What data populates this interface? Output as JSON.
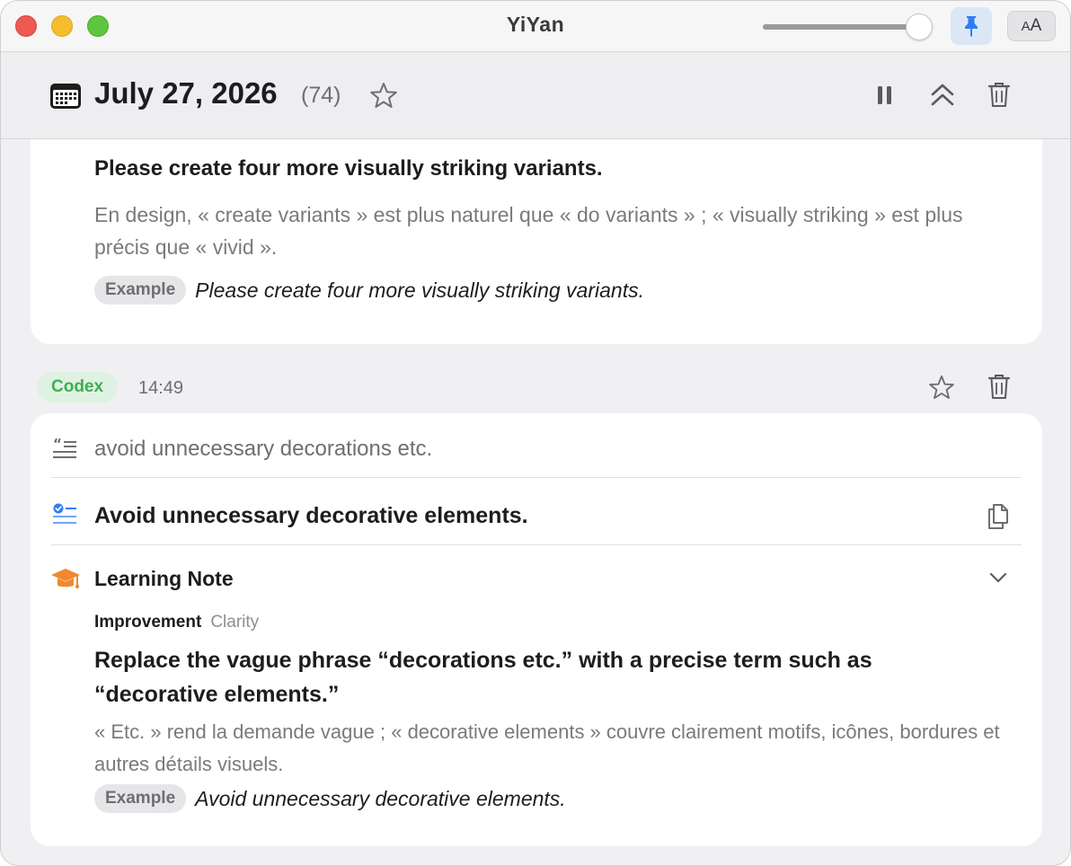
{
  "window": {
    "title": "YiYan"
  },
  "toolbar": {
    "font_label_small": "A",
    "font_label_large": "A",
    "opacity_fraction": 0.9
  },
  "header": {
    "date": "July 27, 2026",
    "count": "(74)"
  },
  "card1": {
    "corrected": "Please create four more visually striking variants.",
    "explanation": "En design, « create variants » est plus naturel que « do variants » ; « visually striking » est plus précis que « vivid ».",
    "example_label": "Example",
    "example": "Please create four more visually striking variants."
  },
  "entry": {
    "source": "Codex",
    "time": "14:49"
  },
  "card2": {
    "original": "avoid unnecessary decorations etc.",
    "corrected": "Avoid unnecessary decorative elements.",
    "note_title": "Learning Note",
    "note_category": "Improvement",
    "note_subcategory": "Clarity",
    "note_heading": "Replace the vague phrase “decorations etc.” with a precise term such as “decorative elements.”",
    "note_explanation": "« Etc. » rend la demande vague ; « decorative elements » couvre clairement motifs, icônes, bordures et autres détails visuels.",
    "example_label": "Example",
    "example": "Avoid unnecessary decorative elements."
  },
  "colors": {
    "accent_blue": "#2f7df6",
    "codex_green": "#3fae52",
    "note_orange": "#f0892e"
  },
  "icons": {
    "calendar": "calendar-icon",
    "star": "star-icon",
    "pause": "pause-icon",
    "collapse": "chevron-double-up-icon",
    "trash": "trash-icon",
    "pin": "pin-icon",
    "quote": "quote-icon",
    "checklist": "checklist-icon",
    "copy": "copy-icon",
    "graduation": "graduation-cap-icon",
    "chevron": "chevron-down-icon"
  }
}
